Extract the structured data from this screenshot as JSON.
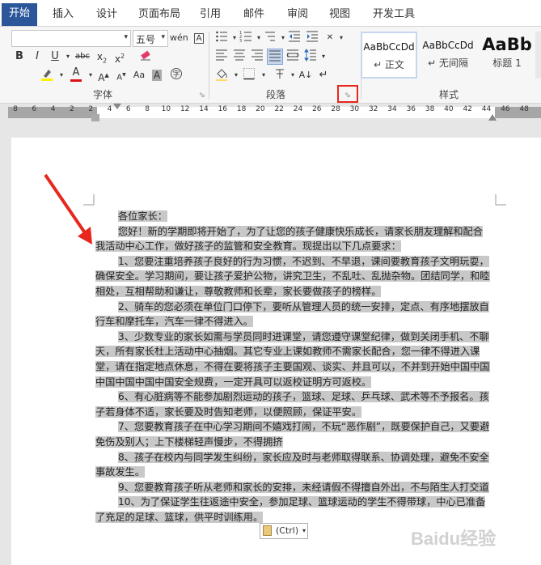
{
  "tabs": [
    "开始",
    "插入",
    "设计",
    "页面布局",
    "引用",
    "邮件",
    "审阅",
    "视图",
    "开发工具"
  ],
  "font": {
    "name_value": "",
    "size_value": "五号",
    "group_label": "字体"
  },
  "paragraph": {
    "group_label": "段落"
  },
  "styles": {
    "group_label": "样式",
    "items": [
      {
        "sample": "AaBbCcDd",
        "name": "↵ 正文"
      },
      {
        "sample": "AaBbCcDd",
        "name": "↵ 无间隔"
      },
      {
        "sample": "AaBb",
        "name": "标题 1"
      }
    ]
  },
  "ruler": {
    "numbers": [
      "8",
      "6",
      "4",
      "2",
      "2",
      "4",
      "6",
      "8",
      "10",
      "12",
      "14",
      "16",
      "18",
      "20",
      "22",
      "24",
      "26",
      "28",
      "30",
      "32",
      "34",
      "36",
      "38",
      "40",
      "42",
      "44",
      "46",
      "48"
    ]
  },
  "document": {
    "paragraphs": [
      "各位家长：",
      "您好！新的学期即将开始了，为了让您的孩子健康快乐成长，请家长朋友理解和配合我活动中心工作，做好孩子的监管和安全教育。现提出以下几点要求：",
      "1、您要注重培养孩子良好的行为习惯，不迟到、不早退，课间要教育孩子文明玩耍，确保安全。学习期间，要让孩子爱护公物，讲究卫生，不乱吐、乱抛杂物。团结同学，和睦相处，互相帮助和谦让，尊敬教师和长辈，家长要做孩子的榜样。",
      "2、骑车的您必须在单位门口停下，要听从管理人员的统一安排，定点、有序地摆放自行车和摩托车，汽车一律不得进入。",
      "3、少数专业的家长如需与学员同时进课堂，请您遵守课堂纪律，做到关闭手机、不聊天，所有家长杜上活动中心抽烟。其它专业上课如教师不需家长配合，您一律不得进入课堂，请在指定地点休息，不得在要将孩子主要国观、谈实、并且可以，不并到开始中国中国中国中国中国中国安全规费，一定开具可以返校证明方可返校。",
      "6、有心脏病等不能参加剧烈运动的孩子，篮球、足球、乒乓球、武术等不予报名。孩子若身体不适，家长要及时告知老师，以便照顾，保证平安。",
      "7、您要教育孩子在中心学习期间不嬉戏打闹，不玩“恶作剧”，既要保护自己，又要避免伤及别人；上下楼梯轻声慢步，不得拥挤",
      "8、孩子在校内与同学发生纠纷，家长应及时与老师取得联系、协调处理，避免不安全事故发生。",
      "9、您要教育孩子听从老师和家长的安排，未经请假不得擅自外出，不与陌生人打交道",
      "10、为了保证学生往返途中安全，参加足球、篮球运动的学生不得带球，中心已准备了充足的足球、篮球，供平时训练用。"
    ]
  },
  "paste_options": {
    "label": "(Ctrl)"
  },
  "watermark": "Baidu经验",
  "colors": {
    "accent": "#2b579a",
    "highlight": "#c8c8c8",
    "annotation": "#e8261d"
  }
}
